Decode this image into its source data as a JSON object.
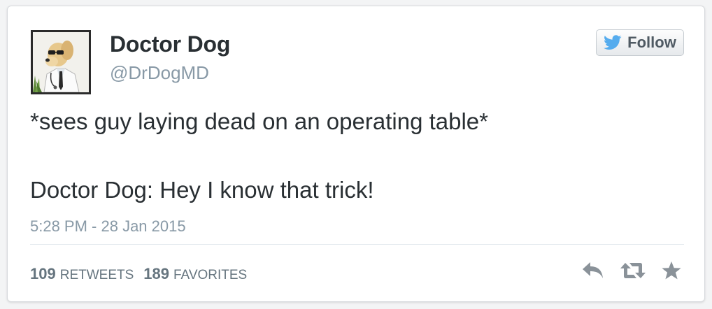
{
  "tweet": {
    "author_name": "Doctor Dog",
    "author_handle": "@DrDogMD",
    "follow_label": "Follow",
    "text_line_1": "*sees guy laying dead on an operating table*",
    "text_line_2": "Doctor Dog: Hey I know that trick!",
    "timestamp": "5:28 PM - 28 Jan 2015",
    "retweets_count": "109",
    "retweets_label": "RETWEETS",
    "favorites_count": "189",
    "favorites_label": "FAVORITES"
  },
  "icons": {
    "follow": "twitter-bird-icon",
    "reply": "reply-icon",
    "retweet": "retweet-icon",
    "favorite": "star-icon"
  },
  "colors": {
    "twitter_blue": "#55acee",
    "text": "#292f33",
    "muted": "#8899a6",
    "action_gray": "#8a9299"
  }
}
